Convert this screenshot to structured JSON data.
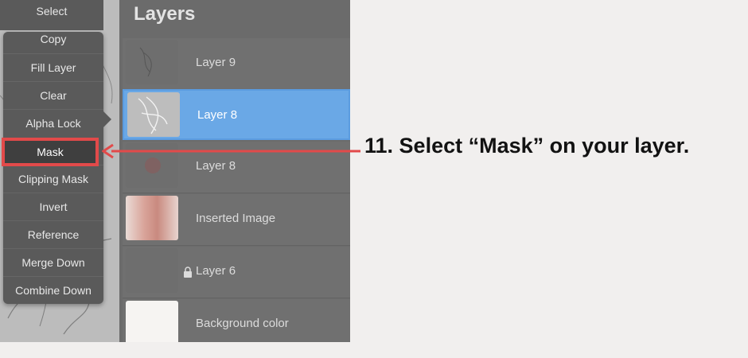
{
  "menu": {
    "items": [
      {
        "label": "Select"
      },
      {
        "label": "Copy"
      },
      {
        "label": "Fill Layer"
      },
      {
        "label": "Clear"
      },
      {
        "label": "Alpha Lock"
      },
      {
        "label": "Mask"
      },
      {
        "label": "Clipping Mask"
      },
      {
        "label": "Invert"
      },
      {
        "label": "Reference"
      },
      {
        "label": "Merge Down"
      },
      {
        "label": "Combine Down"
      }
    ]
  },
  "layers_panel": {
    "title": "Layers",
    "layers": [
      {
        "name": "Layer 9"
      },
      {
        "name": "Layer 8",
        "selected": true
      },
      {
        "name": "Layer 8"
      },
      {
        "name": "Inserted Image"
      },
      {
        "name": "Layer 6",
        "locked": true
      },
      {
        "name": "Background color"
      }
    ]
  },
  "annotation": {
    "text": "11. Select “Mask” on your layer.",
    "color": "#e24a4a"
  },
  "colors": {
    "selected_layer": "#6aa8e6",
    "highlight": "#e24a4a"
  }
}
